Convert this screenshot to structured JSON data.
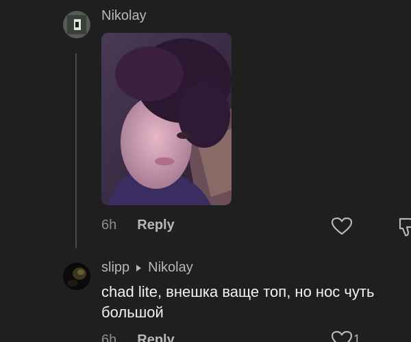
{
  "comments": [
    {
      "username": "Nikolay",
      "time": "6h",
      "reply_label": "Reply"
    },
    {
      "username": "slipp",
      "reply_to": "Nikolay",
      "text": "chad lite, внешка ваще топ, но нос чуть большой",
      "time": "6h",
      "reply_label": "Reply",
      "like_count": "1"
    }
  ],
  "icons": {
    "like": "heart-icon",
    "dislike": "thumbs-down-icon",
    "reply_arrow": "caret-right-icon"
  },
  "colors": {
    "background": "#1f1f1f",
    "muted_text": "#b8b8b8",
    "body_text": "#f2f2f2"
  }
}
